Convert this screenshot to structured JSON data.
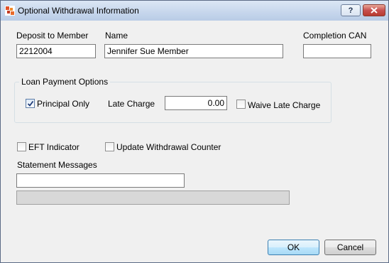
{
  "window": {
    "title": "Optional Withdrawal Information",
    "help_glyph": "?"
  },
  "fields": {
    "deposit_to_member": {
      "label": "Deposit to Member",
      "value": "2212004"
    },
    "name": {
      "label": "Name",
      "value": "Jennifer Sue Member"
    },
    "completion_can": {
      "label": "Completion CAN",
      "value": ""
    }
  },
  "loan_payment_options": {
    "title": "Loan Payment Options",
    "principal_only": {
      "label": "Principal Only",
      "checked": true
    },
    "late_charge": {
      "label": "Late Charge",
      "value": "0.00"
    },
    "waive_late_charge": {
      "label": "Waive Late Charge",
      "checked": false
    }
  },
  "options": {
    "eft_indicator": {
      "label": "EFT Indicator",
      "checked": false
    },
    "update_withdrawal_counter": {
      "label": "Update Withdrawal Counter",
      "checked": false
    }
  },
  "statement_messages": {
    "label": "Statement Messages",
    "line1": "",
    "line2": ""
  },
  "buttons": {
    "ok": "OK",
    "cancel": "Cancel"
  },
  "icons": {
    "app": "app-icon",
    "help": "help-icon",
    "close": "close-icon",
    "check": "checkmark-icon"
  },
  "colors": {
    "title_bar": "#c6d6ec",
    "close_button": "#c75050",
    "default_button": "#3c7fb1",
    "window_bg": "#f0f0f0"
  }
}
